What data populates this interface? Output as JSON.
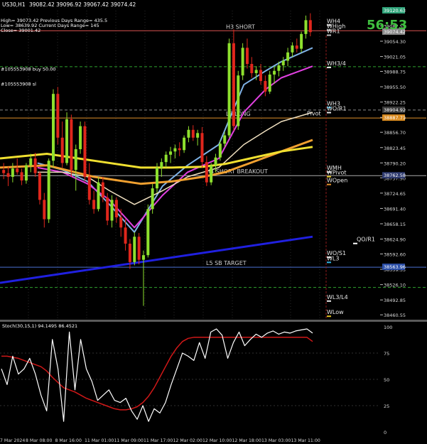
{
  "window": {
    "title": "US30,H1",
    "ohlc": "39082.42 39096.92 39067.42 39074.42",
    "countdown": "56:53"
  },
  "info_lines": [
    "High= 39073.42   Previous Days Range= 435.5",
    "Low= 38639.92   Current Days Range= 145",
    "Close= 39001.42"
  ],
  "orders": [
    {
      "label": "#105553908 sl",
      "price": 38957.8
    },
    {
      "label": "#105553908 buy 50.00",
      "price": 38990.5
    }
  ],
  "price_axis": {
    "ticks": [
      39087.55,
      39054.3,
      39021.05,
      38988.75,
      38955.5,
      38922.25,
      38889.0,
      38856.7,
      38823.45,
      38790.2,
      38757.9,
      38724.65,
      38691.4,
      38658.15,
      38624.9,
      38592.6,
      38559.35,
      38526.1,
      38492.85,
      38460.55
    ],
    "tags": [
      {
        "text": "39120.63",
        "price": 39120.63,
        "color": "#2fa37a"
      },
      {
        "text": "39074.42",
        "price": 39074.42,
        "color": "#8a8a8a"
      },
      {
        "text": "38904.92",
        "price": 38904.92,
        "color": "#3a3a3a"
      },
      {
        "text": "38887.71",
        "price": 38887.71,
        "color": "#d88a20"
      },
      {
        "text": "38762.58",
        "price": 38762.58,
        "color": "#2e3a6e"
      },
      {
        "text": "38563.96",
        "price": 38563.96,
        "color": "#2b4fa8"
      }
    ]
  },
  "time_axis": {
    "labels": [
      "7 Mar 2024",
      "8 Mar 08:00",
      "8 Mar 16:00",
      "11 Mar 01:00",
      "11 Mar 09:00",
      "11 Mar 17:00",
      "12 Mar 02:00",
      "12 Mar 10:00",
      "12 Mar 18:00",
      "13 Mar 03:00",
      "13 Mar 11:00"
    ]
  },
  "levels": [
    {
      "label": "H3 SHORT",
      "price": 39077.0,
      "color": "#d9534f",
      "style": "solid"
    },
    {
      "label": "",
      "price": 38999.0,
      "color": "#2fa32f",
      "style": "dash"
    },
    {
      "label": "",
      "price": 38904.9,
      "color": "#888888",
      "style": "dash"
    },
    {
      "label": "L3 LONG",
      "price": 38887.7,
      "color": "#e0902a",
      "style": "solid"
    },
    {
      "label": "H4 SHORT BREAKOUT",
      "price": 38762.6,
      "color": "#aaaaaa",
      "style": "solid"
    },
    {
      "label": "L5 SB TARGET",
      "price": 38563.9,
      "color": "#4a6fd0",
      "style": "solid"
    },
    {
      "label": "",
      "price": 38520.0,
      "color": "#2fa32f",
      "style": "dash"
    }
  ],
  "weekly_labels": [
    {
      "text": "WH4",
      "price": 39094.0,
      "mark": "#e6e6e6"
    },
    {
      "text": "WHigh",
      "price": 39083.0,
      "mark": "#c0c0c0"
    },
    {
      "text": "WR1",
      "price": 39072.0,
      "mark": "#c0c0c0"
    },
    {
      "text": "WH3/4",
      "price": 39002.0,
      "mark": "#e6e6e6"
    },
    {
      "text": "WH3",
      "price": 38915.0,
      "mark": "#33b5e5"
    },
    {
      "text": "WO/R1",
      "price": 38904.0,
      "mark": "#e6e6e6"
    },
    {
      "text": "Pivot",
      "price": 38893.0,
      "mark": ""
    },
    {
      "text": "WMH",
      "price": 38775.0,
      "mark": "#e6e6e6"
    },
    {
      "text": "WPivot",
      "price": 38765.0,
      "mark": "#e0c020"
    },
    {
      "text": "WOpen",
      "price": 38748.0,
      "mark": "#e0902a"
    },
    {
      "text": "QO/R1",
      "price": 38620.0,
      "mark": "#ffffff"
    },
    {
      "text": "WO/S1",
      "price": 38590.0,
      "mark": "#e6e6e6"
    },
    {
      "text": "WL3",
      "price": 38579.0,
      "mark": "#33b5e5"
    },
    {
      "text": "WL3/L4",
      "price": 38495.0,
      "mark": "#e6e6e6"
    },
    {
      "text": "WLow",
      "price": 38462.0,
      "mark": "#e0c020"
    }
  ],
  "candles": [
    [
      38775,
      38790,
      38755,
      38768
    ],
    [
      38768,
      38782,
      38740,
      38760
    ],
    [
      38760,
      38790,
      38748,
      38778
    ],
    [
      38778,
      38800,
      38765,
      38770
    ],
    [
      38770,
      38778,
      38742,
      38752
    ],
    [
      38752,
      38790,
      38745,
      38785
    ],
    [
      38785,
      38810,
      38770,
      38800
    ],
    [
      38800,
      38812,
      38760,
      38768
    ],
    [
      38768,
      38772,
      38700,
      38710
    ],
    [
      38710,
      38725,
      38650,
      38668
    ],
    [
      38668,
      38800,
      38660,
      38795
    ],
    [
      38795,
      38950,
      38780,
      38940
    ],
    [
      38940,
      38955,
      38830,
      38845
    ],
    [
      38845,
      38880,
      38780,
      38790
    ],
    [
      38790,
      38900,
      38785,
      38885
    ],
    [
      38885,
      38895,
      38760,
      38775
    ],
    [
      38775,
      38830,
      38730,
      38820
    ],
    [
      38820,
      38880,
      38810,
      38870
    ],
    [
      38870,
      38880,
      38750,
      38760
    ],
    [
      38760,
      38790,
      38700,
      38710
    ],
    [
      38710,
      38730,
      38680,
      38690
    ],
    [
      38690,
      38760,
      38685,
      38748
    ],
    [
      38748,
      38760,
      38705,
      38715
    ],
    [
      38715,
      38725,
      38655,
      38665
    ],
    [
      38665,
      38720,
      38650,
      38710
    ],
    [
      38710,
      38716,
      38660,
      38672
    ],
    [
      38672,
      38690,
      38630,
      38650
    ],
    [
      38650,
      38668,
      38600,
      38615
    ],
    [
      38615,
      38625,
      38560,
      38575
    ],
    [
      38575,
      38640,
      38568,
      38630
    ],
    [
      38630,
      38638,
      38570,
      38580
    ],
    [
      38580,
      38600,
      38480,
      38590
    ],
    [
      38590,
      38700,
      38585,
      38690
    ],
    [
      38690,
      38745,
      38680,
      38735
    ],
    [
      38735,
      38790,
      38725,
      38780
    ],
    [
      38780,
      38800,
      38760,
      38792
    ],
    [
      38792,
      38815,
      38780,
      38808
    ],
    [
      38808,
      38825,
      38790,
      38815
    ],
    [
      38815,
      38830,
      38800,
      38822
    ],
    [
      38822,
      38835,
      38805,
      38818
    ],
    [
      38818,
      38850,
      38812,
      38845
    ],
    [
      38845,
      38870,
      38835,
      38862
    ],
    [
      38862,
      38872,
      38838,
      38845
    ],
    [
      38845,
      38862,
      38828,
      38855
    ],
    [
      38855,
      38868,
      38780,
      38792
    ],
    [
      38792,
      38805,
      38740,
      38748
    ],
    [
      38748,
      38790,
      38742,
      38785
    ],
    [
      38785,
      38810,
      38770,
      38802
    ],
    [
      38802,
      38840,
      38795,
      38832
    ],
    [
      38832,
      38858,
      38825,
      38850
    ],
    [
      38850,
      39060,
      38845,
      39050
    ],
    [
      39050,
      39080,
      38860,
      38870
    ],
    [
      38870,
      38990,
      38862,
      38980
    ],
    [
      38980,
      39050,
      38970,
      39040
    ],
    [
      39040,
      39060,
      38995,
      39005
    ],
    [
      39005,
      39020,
      38975,
      38985
    ],
    [
      38985,
      39000,
      38970,
      38992
    ],
    [
      38992,
      39005,
      38960,
      38968
    ],
    [
      38968,
      38980,
      38935,
      38945
    ],
    [
      38945,
      38990,
      38940,
      38982
    ],
    [
      38982,
      39000,
      38962,
      38990
    ],
    [
      38990,
      39010,
      38978,
      39002
    ],
    [
      39002,
      39020,
      38990,
      39012
    ],
    [
      39012,
      39040,
      39000,
      39030
    ],
    [
      39030,
      39052,
      39020,
      39045
    ],
    [
      39045,
      39060,
      39030,
      39038
    ],
    [
      39038,
      39075,
      39030,
      39070
    ],
    [
      39070,
      39110,
      39060,
      39100
    ],
    [
      39100,
      39115,
      39065,
      39074
    ]
  ],
  "ma": [
    {
      "name": "MA1",
      "color": "#7fb2e6",
      "width": 2,
      "x": [
        0.12,
        0.2,
        0.28,
        0.35,
        0.43,
        0.52,
        0.6,
        0.7,
        0.78,
        0.85,
        0.9,
        1.0
      ],
      "y": [
        38790,
        38775,
        38750,
        38700,
        38640,
        38740,
        38785,
        38830,
        38960,
        38990,
        39010,
        39040
      ]
    },
    {
      "name": "MA2",
      "color": "#e040e0",
      "width": 2,
      "x": [
        0.12,
        0.2,
        0.28,
        0.35,
        0.43,
        0.52,
        0.6,
        0.7,
        0.78,
        0.85,
        0.9,
        1.0
      ],
      "y": [
        38780,
        38770,
        38745,
        38710,
        38650,
        38720,
        38770,
        38800,
        38900,
        38950,
        38975,
        39000
      ]
    },
    {
      "name": "MA3",
      "color": "#f0e0c0",
      "width": 1.5,
      "x": [
        0.12,
        0.2,
        0.28,
        0.35,
        0.43,
        0.52,
        0.6,
        0.7,
        0.78,
        0.85,
        0.9,
        1.0
      ],
      "y": [
        38770,
        38770,
        38760,
        38730,
        38700,
        38730,
        38760,
        38780,
        38830,
        38860,
        38880,
        38900
      ]
    },
    {
      "name": "MA4",
      "color": "#f0a030",
      "width": 3,
      "x": [
        0.0,
        0.15,
        0.3,
        0.45,
        0.55,
        0.65,
        0.72,
        0.8,
        0.9,
        1.0
      ],
      "y": [
        38780,
        38785,
        38760,
        38745,
        38750,
        38760,
        38770,
        38790,
        38815,
        38840
      ]
    },
    {
      "name": "MA5",
      "color": "#f0e030",
      "width": 3,
      "x": [
        0.0,
        0.15,
        0.3,
        0.45,
        0.55,
        0.65,
        0.72,
        0.8,
        0.9,
        1.0
      ],
      "y": [
        38800,
        38810,
        38795,
        38780,
        38780,
        38782,
        38788,
        38800,
        38815,
        38825
      ]
    },
    {
      "name": "MA6",
      "color": "#2020e0",
      "width": 3,
      "x": [
        0.0,
        1.0
      ],
      "y": [
        38530,
        38630
      ]
    }
  ],
  "stoch": {
    "label": "Stoch(30,15,1) 94.1495 86.4521",
    "ticks": [
      100,
      75,
      50,
      25,
      0
    ],
    "main": {
      "color": "#ffffff",
      "values": [
        60,
        45,
        72,
        55,
        60,
        70,
        55,
        35,
        20,
        88,
        60,
        10,
        95,
        40,
        88,
        60,
        48,
        30,
        35,
        40,
        30,
        28,
        32,
        20,
        12,
        25,
        10,
        22,
        18,
        28,
        45,
        60,
        75,
        72,
        68,
        85,
        70,
        95,
        98,
        92,
        70,
        85,
        95,
        82,
        88,
        93,
        90,
        94,
        96,
        93,
        95,
        94,
        96,
        97,
        98,
        94
      ]
    },
    "signal": {
      "color": "#d01818",
      "values": [
        72,
        72,
        71,
        70,
        68,
        66,
        64,
        62,
        58,
        52,
        47,
        42,
        40,
        38,
        35,
        32,
        30,
        28,
        26,
        24,
        22,
        21,
        21,
        22,
        24,
        28,
        34,
        42,
        52,
        62,
        72,
        80,
        86,
        89,
        90,
        90,
        90,
        90,
        90,
        90,
        90,
        90,
        90,
        90,
        90,
        90,
        90,
        90,
        90,
        90,
        90,
        90,
        90,
        90,
        90,
        86
      ]
    }
  }
}
